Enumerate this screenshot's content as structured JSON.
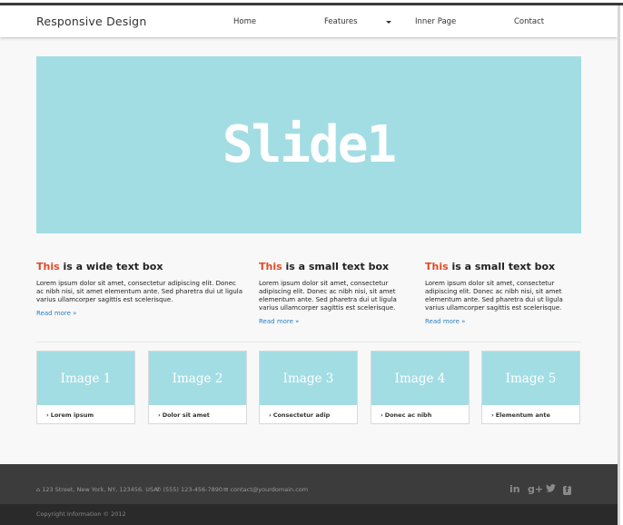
{
  "header": {
    "brand": "Responsive Design",
    "nav": [
      {
        "label": "Home"
      },
      {
        "label": "Features"
      },
      {
        "label": "Inner Page"
      },
      {
        "label": "Contact"
      }
    ]
  },
  "slider": {
    "text": "Slide1"
  },
  "boxes": [
    {
      "highlight": "This",
      "title_rest": " is a wide text box",
      "body": "Lorem ipsum dolor sit amet, consectetur adipiscing elit. Donec ac nibh nisi, sit amet elementum ante. Sed pharetra dui ut ligula varius ullamcorper sagittis est scelerisque.",
      "link": "Read more »"
    },
    {
      "highlight": "This",
      "title_rest": " is a small text box",
      "body": "Lorem ipsum dolor sit amet, consectetur adipiscing elit. Donec ac nibh nisi, sit amet elementum ante. Sed pharetra dui ut ligula varius ullamcorper sagittis est scelerisque.",
      "link": "Read more »"
    },
    {
      "highlight": "This",
      "title_rest": " is a small text box",
      "body": "Lorem ipsum dolor sit amet, consectetur adipiscing elit. Donec ac nibh nisi, sit amet elementum ante. Sed pharetra dui ut ligula varius ullamcorper sagittis est scelerisque.",
      "link": "Read more »"
    }
  ],
  "cards": [
    {
      "image_label": "Image 1",
      "caption": "Lorem ipsum"
    },
    {
      "image_label": "Image 2",
      "caption": "Dolor sit amet"
    },
    {
      "image_label": "Image 3",
      "caption": "Consectetur adip"
    },
    {
      "image_label": "Image 4",
      "caption": "Donec ac nibh"
    },
    {
      "image_label": "Image 5",
      "caption": "Elementum ante"
    }
  ],
  "footer": {
    "address": "123 Street, New York, NY, 123456. USA",
    "phone": "(555) 123-456-7890",
    "email": "contact@yourdomain.com",
    "social": {
      "linkedin": "in",
      "googleplus": "g+",
      "facebook": "f"
    },
    "copyright": "Copyright Information © 2012"
  },
  "colors": {
    "accent": "#e04a28",
    "link": "#2a7fc1",
    "slide": "#a3dde4",
    "footer": "#3c3c3c"
  }
}
